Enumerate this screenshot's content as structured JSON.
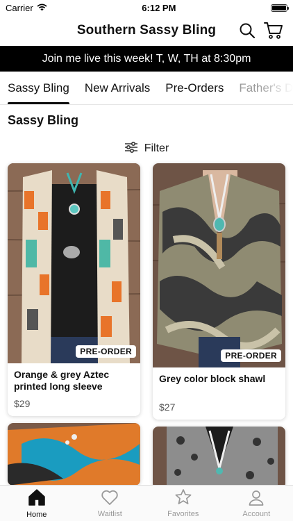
{
  "status": {
    "carrier": "Carrier",
    "time": "6:12 PM"
  },
  "header": {
    "title": "Southern Sassy Bling"
  },
  "banner": {
    "text": "Join me live this week! T, W, TH at 8:30pm"
  },
  "tabs": [
    {
      "label": "Sassy Bling"
    },
    {
      "label": "New Arrivals"
    },
    {
      "label": "Pre-Orders"
    },
    {
      "label": "Father's Day"
    }
  ],
  "section": {
    "title": "Sassy Bling",
    "filter_label": "Filter"
  },
  "products": [
    {
      "name": "Orange & grey Aztec printed long sleeve",
      "price": "$29",
      "badge": "PRE-ORDER"
    },
    {
      "name": "Grey color block shawl",
      "price": "$27",
      "badge": "PRE-ORDER"
    }
  ],
  "nav": [
    {
      "label": "Home"
    },
    {
      "label": "Waitlist"
    },
    {
      "label": "Favorites"
    },
    {
      "label": "Account"
    }
  ],
  "colors": {
    "banner_bg": "#000000",
    "accent": "#111111",
    "badge_bg": "#ffffff"
  }
}
